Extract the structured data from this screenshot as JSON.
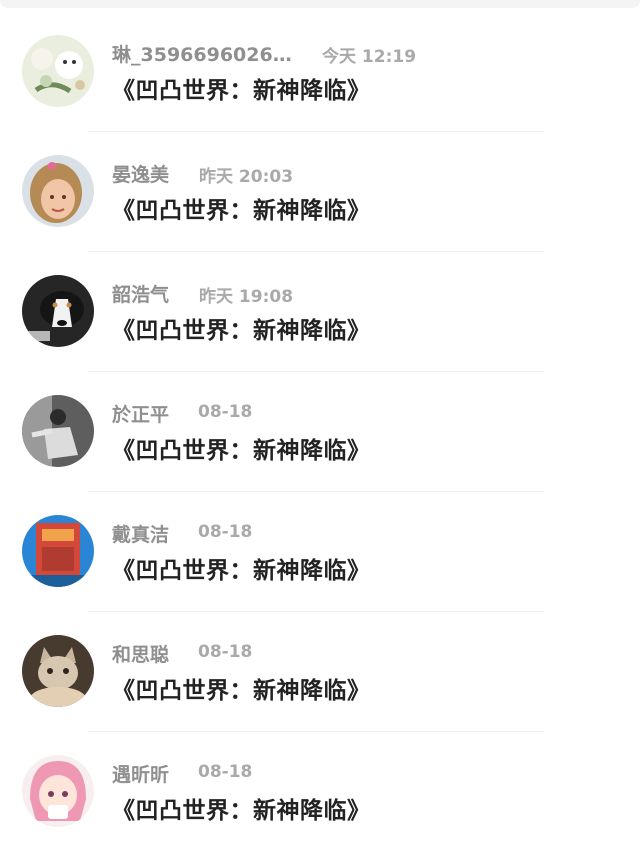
{
  "conversations": [
    {
      "name": "琳_3596696026…",
      "time": "今天 12:19",
      "message": "《凹凸世界：新神降临》",
      "avatar": "cartoon-avatar-icon"
    },
    {
      "name": "晏逸美",
      "time": "昨天 20:03",
      "message": "《凹凸世界：新神降临》",
      "avatar": "girl-photo-avatar"
    },
    {
      "name": "韶浩气",
      "time": "昨天 19:08",
      "message": "《凹凸世界：新神降临》",
      "avatar": "dog-photo-avatar"
    },
    {
      "name": "於正平",
      "time": "08-18",
      "message": "《凹凸世界：新神降临》",
      "avatar": "bw-photo-avatar"
    },
    {
      "name": "戴真洁",
      "time": "08-18",
      "message": "《凹凸世界：新神降临》",
      "avatar": "blue-red-avatar"
    },
    {
      "name": "和思聪",
      "time": "08-18",
      "message": "《凹凸世界：新神降临》",
      "avatar": "cat-photo-avatar"
    },
    {
      "name": "遇昕昕",
      "time": "08-18",
      "message": "《凹凸世界：新神降临》",
      "avatar": "anime-girl-avatar"
    }
  ]
}
